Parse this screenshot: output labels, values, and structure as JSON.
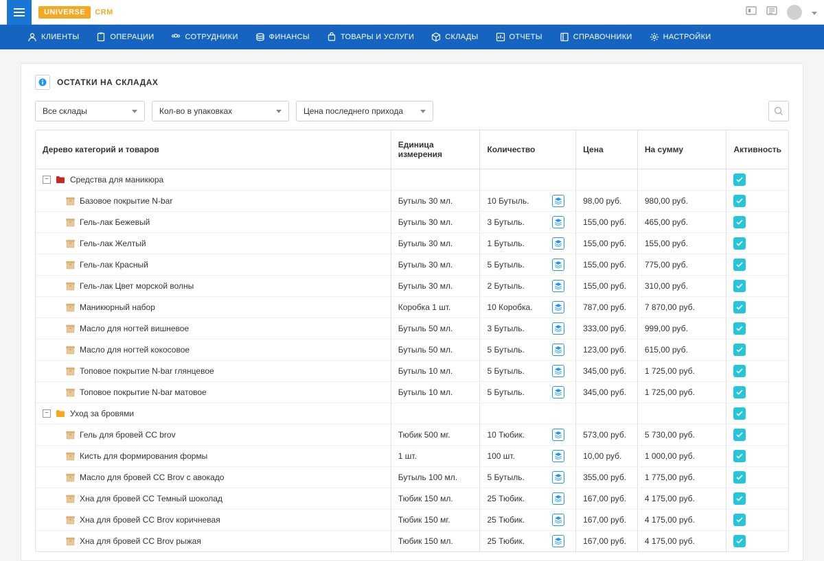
{
  "brand": {
    "main": "UNIVERSE",
    "sub": "CRM"
  },
  "nav": [
    {
      "label": "КЛИЕНТЫ"
    },
    {
      "label": "ОПЕРАЦИИ"
    },
    {
      "label": "СОТРУДНИКИ"
    },
    {
      "label": "ФИНАНСЫ"
    },
    {
      "label": "ТОВАРЫ И УСЛУГИ"
    },
    {
      "label": "СКЛАДЫ"
    },
    {
      "label": "ОТЧЕТЫ"
    },
    {
      "label": "СПРАВОЧНИКИ"
    },
    {
      "label": "НАСТРОЙКИ"
    }
  ],
  "page_title": "ОСТАТКИ НА СКЛАДАХ",
  "filters": {
    "warehouse": "Все склады",
    "qty_mode": "Кол-во в упаковках",
    "price_mode": "Цена последнего прихода"
  },
  "columns": {
    "tree": "Дерево категорий и товаров",
    "unit": "Единица измерения",
    "qty": "Количество",
    "price": "Цена",
    "sum": "На сумму",
    "active": "Активность"
  },
  "categories": [
    {
      "name": "Средства для маникюра",
      "color": "#c62828",
      "items": [
        {
          "name": "Базовое покрытие N-bar",
          "unit": "Бутыль 30 мл.",
          "qty": "10 Бутыль.",
          "price": "98,00 руб.",
          "sum": "980,00 руб."
        },
        {
          "name": "Гель-лак Бежевый",
          "unit": "Бутыль 30 мл.",
          "qty": "3 Бутыль.",
          "price": "155,00 руб.",
          "sum": "465,00 руб."
        },
        {
          "name": "Гель-лак Желтый",
          "unit": "Бутыль 30 мл.",
          "qty": "1 Бутыль.",
          "price": "155,00 руб.",
          "sum": "155,00 руб."
        },
        {
          "name": "Гель-лак Красный",
          "unit": "Бутыль 30 мл.",
          "qty": "5 Бутыль.",
          "price": "155,00 руб.",
          "sum": "775,00 руб."
        },
        {
          "name": "Гель-лак Цвет морской волны",
          "unit": "Бутыль 30 мл.",
          "qty": "2 Бутыль.",
          "price": "155,00 руб.",
          "sum": "310,00 руб."
        },
        {
          "name": "Маникюрный набор",
          "unit": "Коробка 1 шт.",
          "qty": "10 Коробка.",
          "price": "787,00 руб.",
          "sum": "7 870,00 руб."
        },
        {
          "name": "Масло для ногтей вишневое",
          "unit": "Бутыль 50 мл.",
          "qty": "3 Бутыль.",
          "price": "333,00 руб.",
          "sum": "999,00 руб."
        },
        {
          "name": "Масло для ногтей кокосовое",
          "unit": "Бутыль 50 мл.",
          "qty": "5 Бутыль.",
          "price": "123,00 руб.",
          "sum": "615,00 руб."
        },
        {
          "name": "Топовое покрытие N-bar глянцевое",
          "unit": "Бутыль 10 мл.",
          "qty": "5 Бутыль.",
          "price": "345,00 руб.",
          "sum": "1 725,00 руб."
        },
        {
          "name": "Топовое покрытие N-bar матовое",
          "unit": "Бутыль 10 мл.",
          "qty": "5 Бутыль.",
          "price": "345,00 руб.",
          "sum": "1 725,00 руб."
        }
      ]
    },
    {
      "name": "Уход за бровями",
      "color": "#f7a823",
      "items": [
        {
          "name": "Гель для бровей CC brov",
          "unit": "Тюбик 500 мг.",
          "qty": "10 Тюбик.",
          "price": "573,00 руб.",
          "sum": "5 730,00 руб."
        },
        {
          "name": "Кисть для формирования формы",
          "unit": "1 шт.",
          "qty": "100 шт.",
          "price": "10,00 руб.",
          "sum": "1 000,00 руб."
        },
        {
          "name": "Масло для бровей CC Brov с авокадо",
          "unit": "Бутыль 100 мл.",
          "qty": "5 Бутыль.",
          "price": "355,00 руб.",
          "sum": "1 775,00 руб."
        },
        {
          "name": "Хна для бровей CC Темный шоколад",
          "unit": "Тюбик 150 мл.",
          "qty": "25 Тюбик.",
          "price": "167,00 руб.",
          "sum": "4 175,00 руб."
        },
        {
          "name": "Хна для бровей CC Brov коричневая",
          "unit": "Тюбик 150 мг.",
          "qty": "25 Тюбик.",
          "price": "167,00 руб.",
          "sum": "4 175,00 руб."
        },
        {
          "name": "Хна для бровей CC Brov рыжая",
          "unit": "Тюбик 150 мл.",
          "qty": "25 Тюбик.",
          "price": "167,00 руб.",
          "sum": "4 175,00 руб."
        }
      ]
    }
  ]
}
